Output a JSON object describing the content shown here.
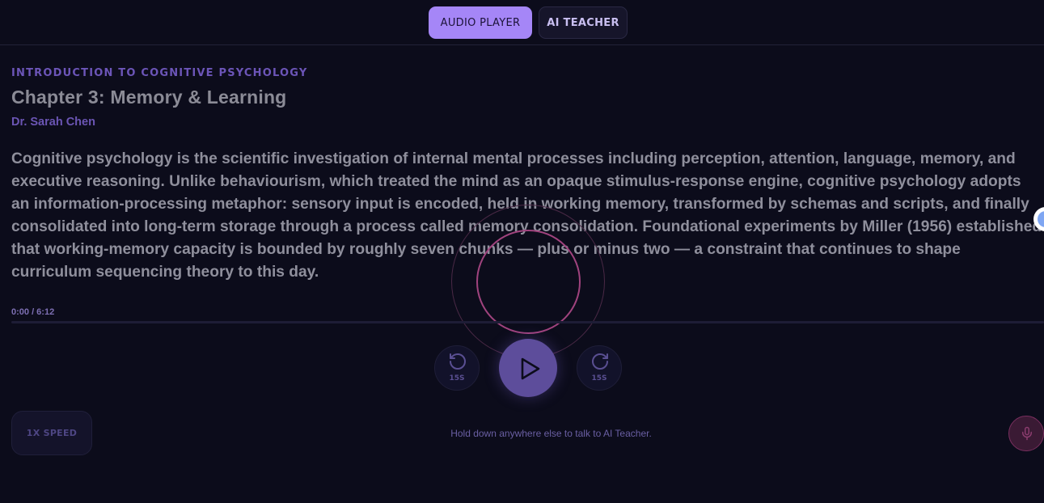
{
  "tabs": {
    "audio_player": "AUDIO PLAYER",
    "ai_teacher": "AI TEACHER"
  },
  "header": {
    "course": "INTRODUCTION TO COGNITIVE PSYCHOLOGY",
    "chapter": "Chapter 3: Memory & Learning",
    "author": "Dr. Sarah Chen"
  },
  "lecture": {
    "text": "Cognitive psychology is the scientific investigation of internal mental processes including perception, attention, language, memory, and executive reasoning. Unlike behaviourism, which treated the mind as an opaque stimulus-response engine, cognitive psychology adopts an information-processing metaphor: sensory input is encoded, held in working memory, transformed by schemas and scripts, and finally consolidated into long-term storage through a process called memory consolidation. Foundational experiments by Miller (1956) established that working-memory capacity is bounded by roughly seven chunks — plus or minus two — a constraint that continues to shape curriculum sequencing theory to this day."
  },
  "player": {
    "time": "0:00 / 6:12",
    "progress_percent": 0,
    "skip_back_label": "15S",
    "skip_forward_label": "15S",
    "speed_label": "1X SPEED",
    "hint": "Hold down anywhere else to talk to AI Teacher."
  },
  "icons": {
    "skip_back": "rotate-ccw-icon",
    "skip_forward": "rotate-cw-icon",
    "play": "play-icon",
    "mic": "mic-icon"
  },
  "colors": {
    "accent": "#a586f7",
    "background": "#0c0c1b",
    "ring": "#a0437e",
    "mic": "#7a2f5f"
  }
}
